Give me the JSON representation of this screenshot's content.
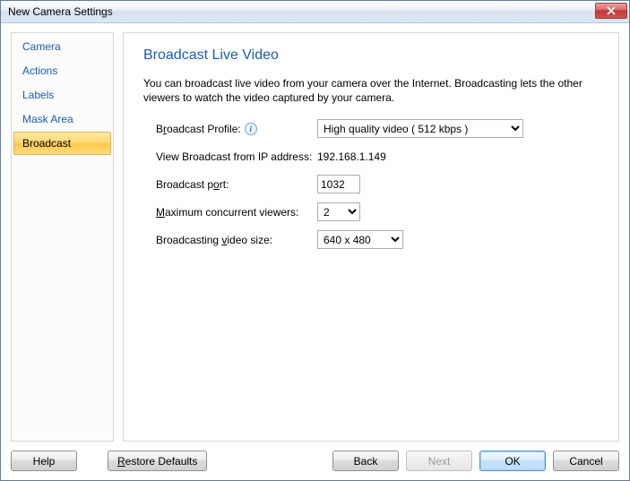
{
  "window": {
    "title": "New Camera Settings"
  },
  "sidebar": {
    "items": [
      {
        "label": "Camera"
      },
      {
        "label": "Actions"
      },
      {
        "label": "Labels"
      },
      {
        "label": "Mask Area"
      },
      {
        "label": "Broadcast"
      }
    ]
  },
  "page": {
    "heading": "Broadcast Live Video",
    "description": "You can broadcast live video from your camera over the Internet. Broadcasting lets the other viewers to watch the video captured by your camera."
  },
  "form": {
    "profile": {
      "label_pre": "B",
      "label_u": "r",
      "label_post": "oadcast Profile:",
      "value": "High quality video ( 512 kbps )"
    },
    "ip": {
      "label": "View Broadcast from IP address:",
      "value": "192.168.1.149"
    },
    "port": {
      "label_pre": "Broadcast p",
      "label_u": "o",
      "label_post": "rt:",
      "value": "1032"
    },
    "viewers": {
      "label_pre": "",
      "label_u": "M",
      "label_post": "aximum concurrent viewers:",
      "value": "2"
    },
    "size": {
      "label_pre": "Broadcasting ",
      "label_u": "v",
      "label_post": "ideo size:",
      "value": "640 x 480"
    }
  },
  "buttons": {
    "help": "Help",
    "restore_u": "R",
    "restore_post": "estore Defaults",
    "back": "Back",
    "next": "Next",
    "ok": "OK",
    "cancel": "Cancel"
  }
}
